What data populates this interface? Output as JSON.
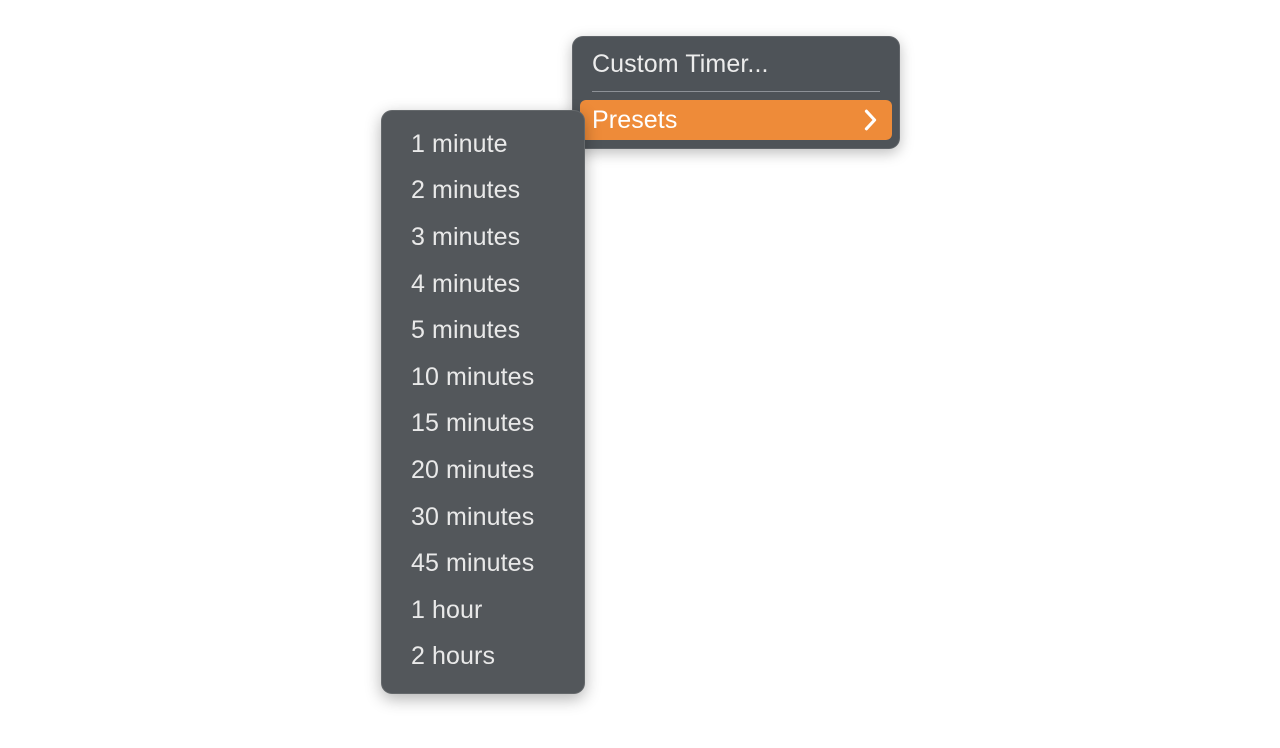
{
  "app": {
    "background_color": "#ffffff"
  },
  "root_menu": {
    "panel_color": "#4e5358",
    "text_color": "#ececec",
    "items": [
      {
        "label": "Custom Timer...",
        "type": "command",
        "highlighted": false,
        "has_submenu": false
      },
      {
        "label": "Presets",
        "type": "submenu",
        "highlighted": true,
        "has_submenu": true,
        "highlight_color": "#ee8b39",
        "highlight_text_color": "#ffffff",
        "submenu_icon": "chevron-right-icon"
      }
    ],
    "separator_after_index": 0,
    "separator_color": "#8d9197"
  },
  "submenu": {
    "title": "Presets",
    "panel_color": "#53575b",
    "text_color": "#e9e9e9",
    "items": [
      {
        "label": "1 minute"
      },
      {
        "label": "2 minutes"
      },
      {
        "label": "3 minutes"
      },
      {
        "label": "4 minutes"
      },
      {
        "label": "5 minutes"
      },
      {
        "label": "10 minutes"
      },
      {
        "label": "15 minutes"
      },
      {
        "label": "20 minutes"
      },
      {
        "label": "30 minutes"
      },
      {
        "label": "45 minutes"
      },
      {
        "label": "1 hour"
      },
      {
        "label": "2 hours"
      }
    ]
  }
}
